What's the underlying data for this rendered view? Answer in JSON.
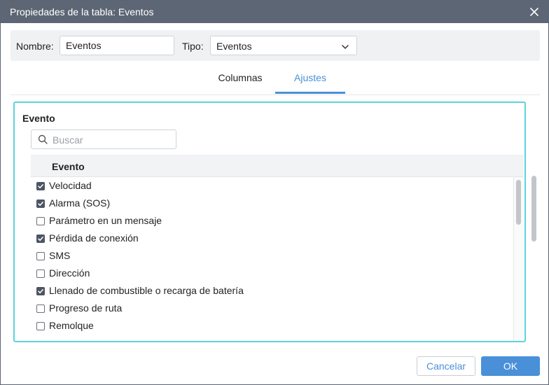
{
  "window": {
    "title": "Propiedades de la tabla: Eventos",
    "close_icon": "close-icon",
    "titlebar_color": "#5d6675"
  },
  "header": {
    "name_label": "Nombre:",
    "name_value": "Eventos",
    "type_label": "Tipo:",
    "type_value": "Eventos"
  },
  "tabs": [
    {
      "label": "Columnas",
      "active": false
    },
    {
      "label": "Ajustes",
      "active": true
    }
  ],
  "accent_color": "#4a90d9",
  "settings": {
    "section_title": "Evento",
    "search_placeholder": "Buscar",
    "column_header": "Evento",
    "items": [
      {
        "label": "Velocidad",
        "checked": true
      },
      {
        "label": "Alarma (SOS)",
        "checked": true
      },
      {
        "label": "Parámetro en un mensaje",
        "checked": false
      },
      {
        "label": "Pérdida de conexión",
        "checked": true
      },
      {
        "label": "SMS",
        "checked": false
      },
      {
        "label": "Dirección",
        "checked": false
      },
      {
        "label": "Llenado de combustible o recarga de batería",
        "checked": true
      },
      {
        "label": "Progreso de ruta",
        "checked": false
      },
      {
        "label": "Remolque",
        "checked": false
      }
    ]
  },
  "buttons": {
    "cancel": "Cancelar",
    "ok": "OK"
  }
}
